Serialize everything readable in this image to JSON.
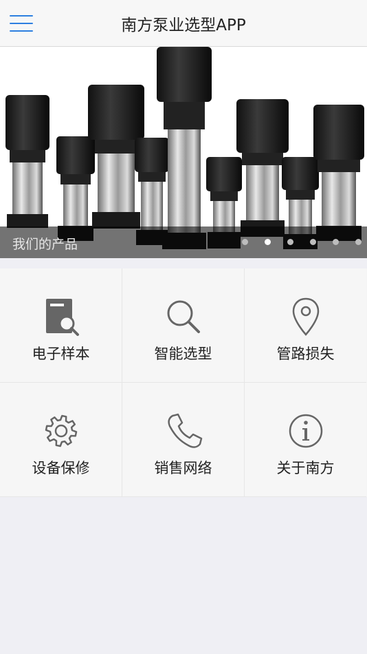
{
  "header": {
    "title": "南方泵业选型APP",
    "menu_icon": "hamburger-menu-icon"
  },
  "banner": {
    "caption": "我们的产品",
    "slide_count": 6,
    "active_slide": 2
  },
  "menu": [
    {
      "label": "电子样本",
      "icon": "catalog-search-icon"
    },
    {
      "label": "智能选型",
      "icon": "magnifier-icon"
    },
    {
      "label": "管路损失",
      "icon": "location-pin-icon"
    },
    {
      "label": "设备保修",
      "icon": "gear-icon"
    },
    {
      "label": "销售网络",
      "icon": "phone-icon"
    },
    {
      "label": "关于南方",
      "icon": "info-icon"
    }
  ],
  "colors": {
    "accent": "#2d7fe0",
    "icon": "#666666",
    "background": "#efeff4"
  }
}
